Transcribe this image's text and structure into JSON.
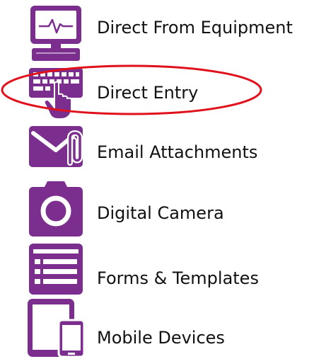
{
  "colors": {
    "icon_purple": "#7b2e8e",
    "highlight_red": "#e0111b",
    "text": "#111111"
  },
  "items": [
    {
      "label": "Direct From Equipment",
      "icon": "monitor-waveform-icon"
    },
    {
      "label": "Direct Entry",
      "icon": "keyboard-hand-icon",
      "highlighted": true
    },
    {
      "label": "Email Attachments",
      "icon": "envelope-paperclip-icon"
    },
    {
      "label": "Digital Camera",
      "icon": "camera-icon"
    },
    {
      "label": "Forms & Templates",
      "icon": "form-list-icon"
    },
    {
      "label": "Mobile Devices",
      "icon": "tablet-phone-icon"
    }
  ]
}
